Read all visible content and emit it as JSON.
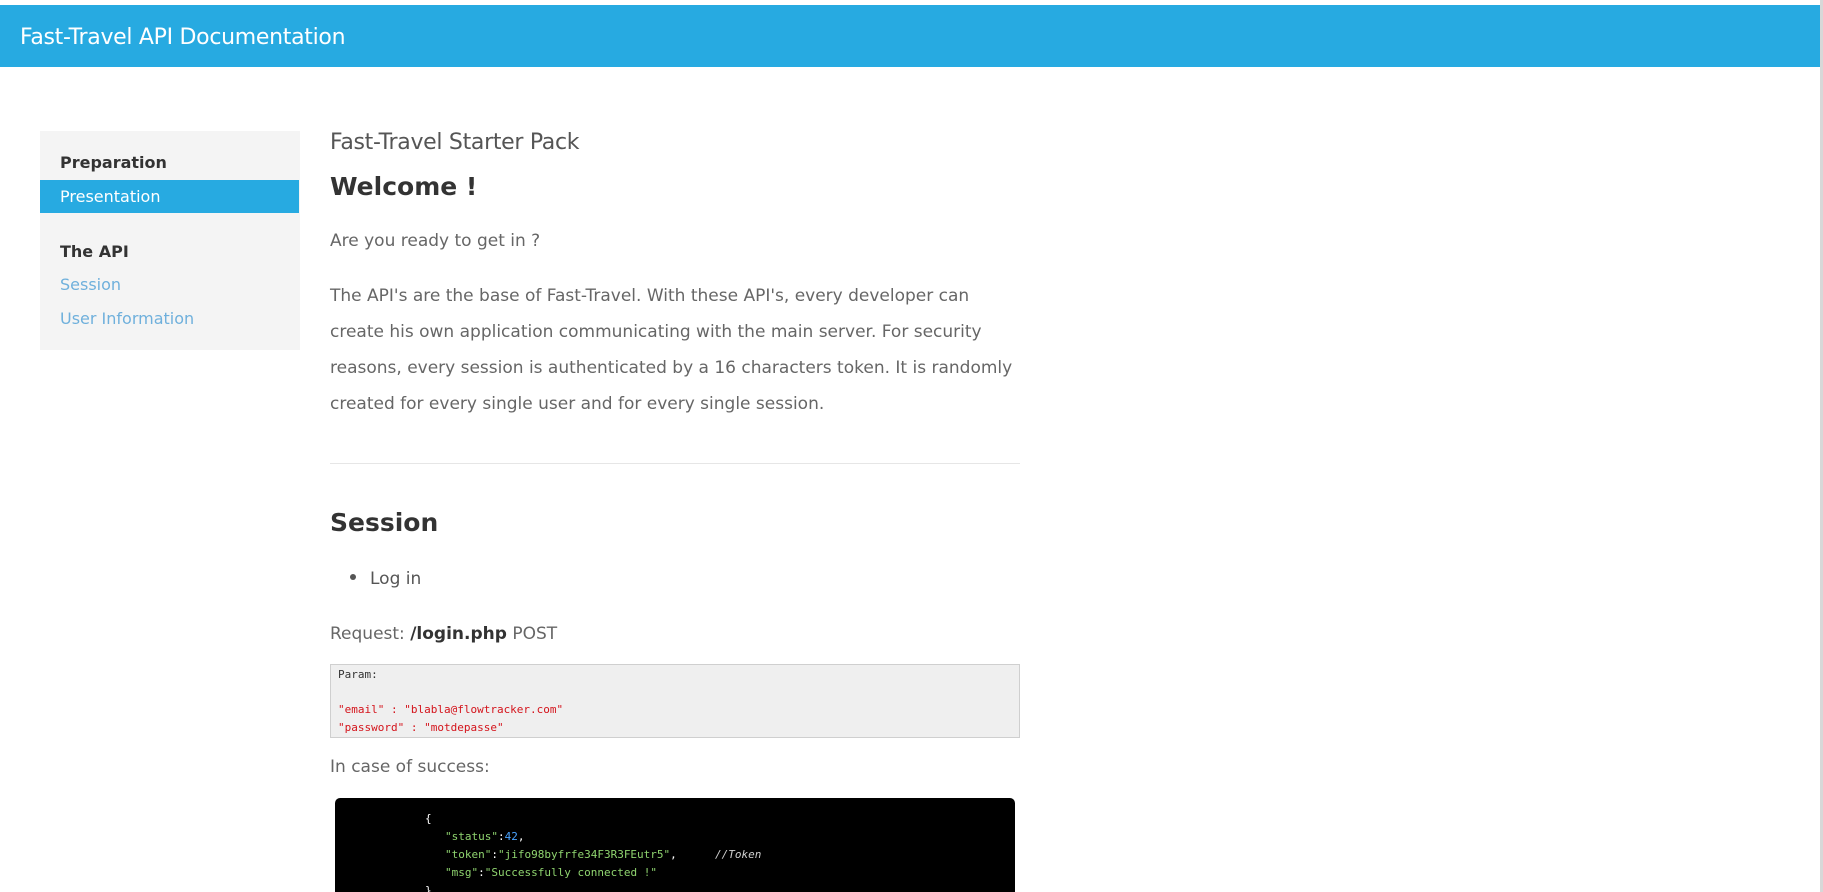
{
  "header": {
    "title": "Fast-Travel API Documentation"
  },
  "sidebar": {
    "sections": [
      {
        "heading": "Preparation",
        "items": [
          {
            "label": "Presentation",
            "active": true
          }
        ]
      },
      {
        "heading": "The API",
        "items": [
          {
            "label": "Session",
            "active": false
          },
          {
            "label": "User Information",
            "active": false
          }
        ]
      }
    ]
  },
  "main": {
    "pack_title": "Fast-Travel Starter Pack",
    "welcome_heading": "Welcome !",
    "intro_question": "Are you ready to get in ?",
    "intro_paragraph": "The API's are the base of Fast-Travel. With these API's, every developer can create his own application communicating with the main server. For security reasons, every session is authenticated by a 16 characters token. It is randomly created for every single user and for every single session.",
    "session_heading": "Session",
    "session_list": [
      "Log in"
    ],
    "request": {
      "prefix": "Request:",
      "path": "/login.php",
      "method": "POST"
    },
    "param_block": {
      "label": "Param:",
      "lines": [
        "\"email\" : \"blabla@flowtracker.com\"",
        "\"password\" : \"motdepasse\""
      ]
    },
    "success_label": "In case of success:",
    "success_code": {
      "open_brace": "{",
      "status_key": "\"status\"",
      "status_value": "42",
      "token_key": "\"token\"",
      "token_value": "\"jifo98byfrfe34F3R3FEutr5\"",
      "token_comment": "//Token",
      "msg_key": "\"msg\"",
      "msg_value": "\"Successfully connected !\"",
      "close_brace": "}"
    }
  },
  "colors": {
    "brand": "#27aae1",
    "link": "#6fb0dc",
    "param_red": "#d4131b",
    "code_bg": "#000000"
  }
}
